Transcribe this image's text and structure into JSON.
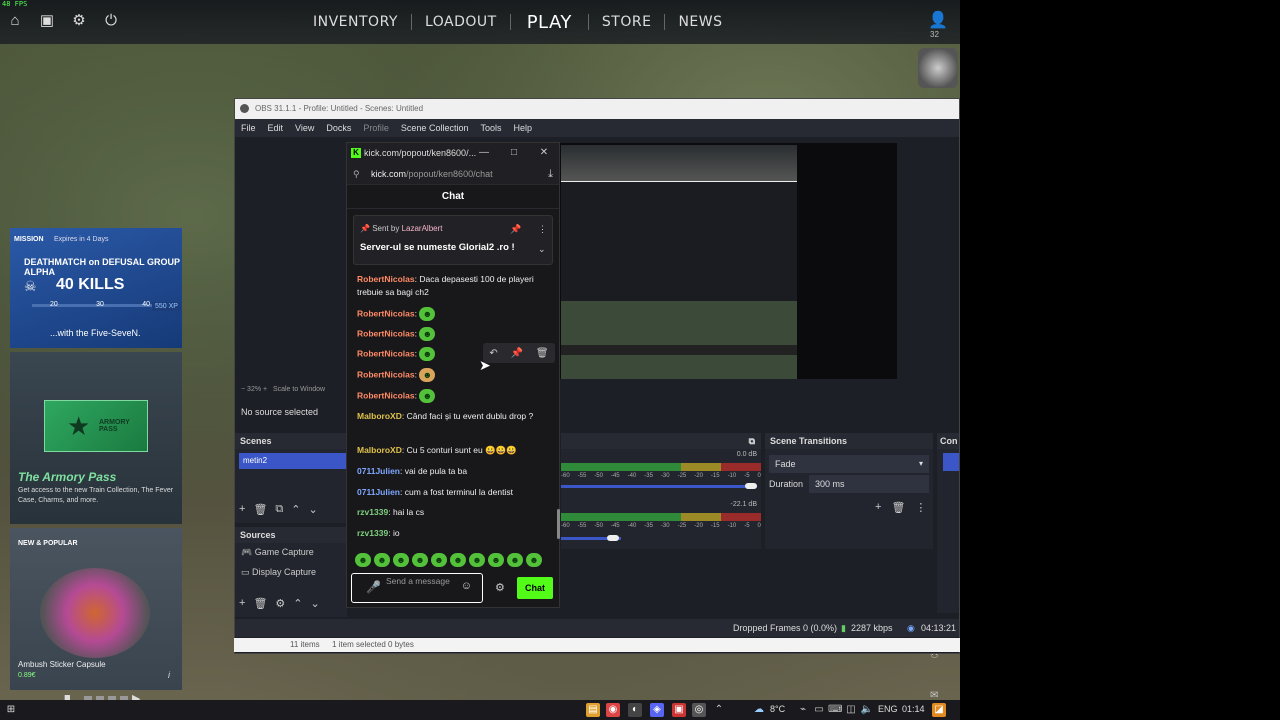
{
  "fps": "48 FPS",
  "game": {
    "nav": [
      "INVENTORY",
      "LOADOUT",
      "PLAY",
      "STORE",
      "NEWS"
    ],
    "profile_count": "32",
    "mission": {
      "tag": "MISSION",
      "expires": "Expires in 4 Days",
      "title": "DEATHMATCH on DEFUSAL GROUP ALPHA",
      "kills": "40 KILLS",
      "ticks": [
        "20",
        "30",
        "40"
      ],
      "xp": "550 XP",
      "with": "...with the Five-SeveN."
    },
    "armory": {
      "pass": "ARMORY PASS",
      "title": "The Armory Pass",
      "desc": "Get access to the new Train Collection, The Fever Case, Charms, and more."
    },
    "sticker": {
      "new": "NEW & POPULAR",
      "name": "Ambush Sticker Capsule",
      "price": "0.89€"
    }
  },
  "obs": {
    "title": "OBS 31.1.1 - Profile: Untitled - Scenes: Untitled",
    "menu": [
      "File",
      "Edit",
      "View",
      "Docks",
      "Profile",
      "Scene Collection",
      "Tools",
      "Help"
    ],
    "zoom": "32%",
    "scale": "Scale to Window",
    "no_source": "No source selected",
    "scenes_header": "Scenes",
    "scene_selected": "metin2",
    "sources_header": "Sources",
    "sources": [
      "Game Capture",
      "Display Capture"
    ],
    "mixer_db1": "0.0 dB",
    "mixer_db2": "-22.1 dB",
    "mixer_scale": [
      "-60",
      "-55",
      "-50",
      "-45",
      "-40",
      "-35",
      "-30",
      "-25",
      "-20",
      "-15",
      "-10",
      "-5",
      "0"
    ],
    "transitions_header": "Scene Transitions",
    "transition": "Fade",
    "duration_label": "Duration",
    "duration": "300 ms",
    "controls_header": "Con",
    "dropped": "Dropped Frames 0 (0.0%)",
    "kbps": "2287 kbps",
    "time": "04:13:21"
  },
  "explorer": {
    "items": "11 items",
    "selected": "1 item selected  0 bytes"
  },
  "kick": {
    "window_title": "kick.com/popout/ken8600/...",
    "url_host": "kick.com",
    "url_path": "/popout/ken8600/chat",
    "header": "Chat",
    "pinned": {
      "sent_by": "Sent by",
      "user": "LazarAlbert",
      "message": "Server-ul se numeste Glorial2 .ro !"
    },
    "messages": [
      {
        "user": "RobertNicolas",
        "text": "Daca depasesti 100 de playeri trebuie sa bagi ch2",
        "color": "#ff8a65"
      },
      {
        "user": "RobertNicolas",
        "text": "",
        "color": "#ff8a65"
      },
      {
        "user": "RobertNicolas",
        "text": "",
        "color": "#ff8a65"
      },
      {
        "user": "RobertNicolas",
        "text": "",
        "color": "#ff8a65"
      },
      {
        "user": "RobertNicolas",
        "text": "",
        "color": "#ff8a65"
      },
      {
        "user": "RobertNicolas",
        "text": "",
        "color": "#ff8a65"
      },
      {
        "user": "MalboroXD",
        "text": "Când faci și tu event dublu drop ?",
        "color": "#e0c24a"
      },
      {
        "user": "MalboroXD",
        "text": "Cu 5 conturi sunt eu 😀😀😀",
        "color": "#e0c24a"
      },
      {
        "user": "0711Julien",
        "text": "vai de pula ta ba",
        "color": "#7fa7ff"
      },
      {
        "user": "0711Julien",
        "text": "cum a fost terminul la dentist",
        "color": "#7fa7ff"
      },
      {
        "user": "rzv1339",
        "text": "hai la cs",
        "color": "#7fd07f"
      },
      {
        "user": "rzv1339",
        "text": "io",
        "color": "#7fd07f"
      }
    ],
    "input_placeholder": "Send a message",
    "chat_button": "Chat"
  },
  "taskbar": {
    "weather": "8°C",
    "lang": "ENG",
    "clock": "01:14"
  },
  "colors": {
    "kick_green": "#53fc18",
    "obs_blue": "#3b56c7"
  }
}
